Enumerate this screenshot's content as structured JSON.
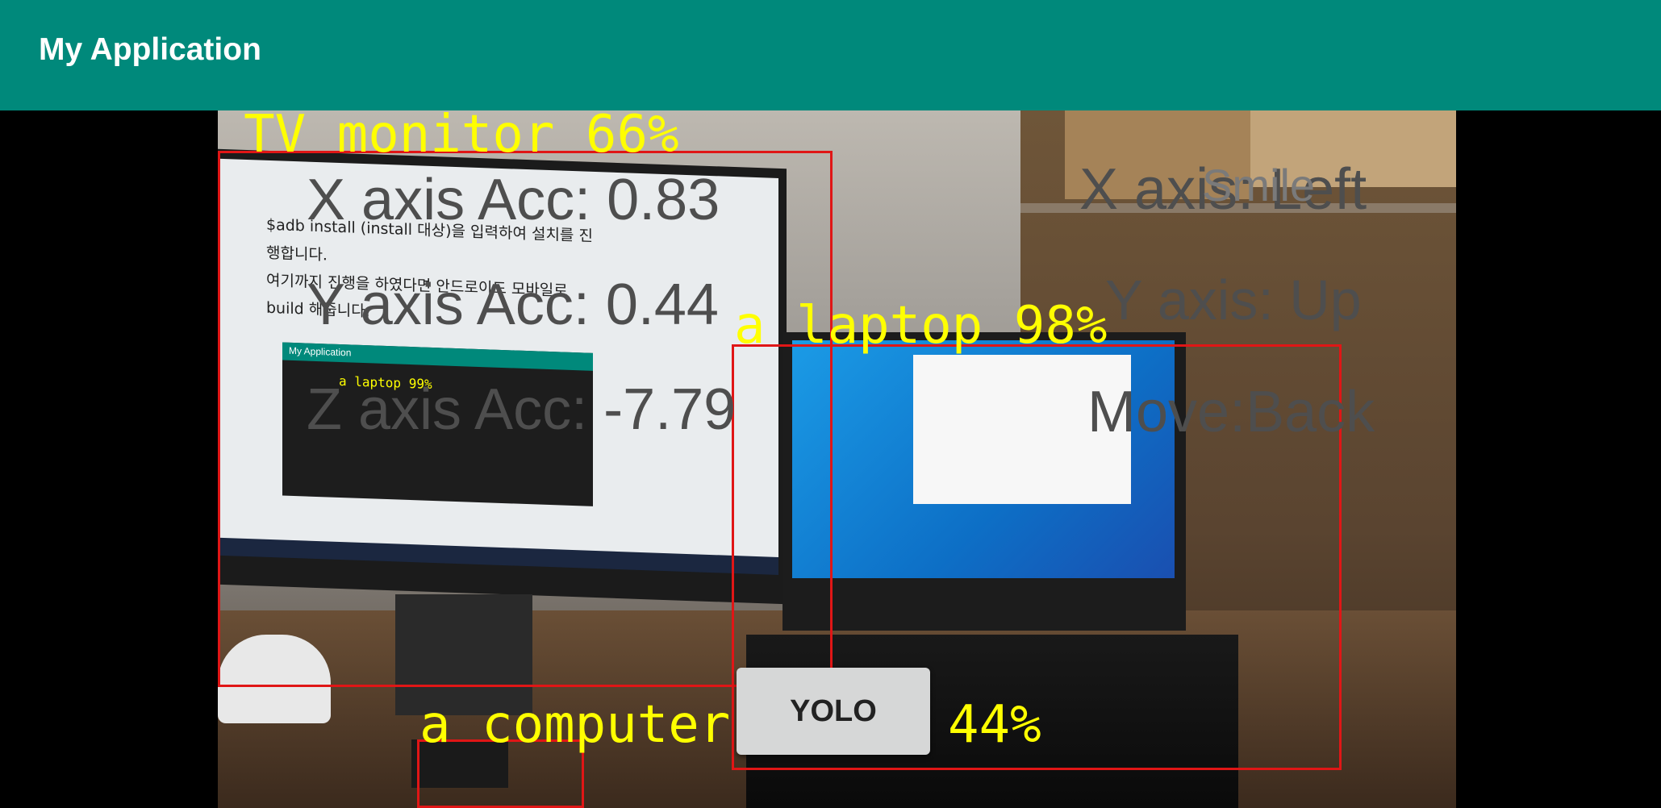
{
  "app": {
    "title": "My Application"
  },
  "detections": [
    {
      "label": "a TV monitor 66%"
    },
    {
      "label": "a laptop 98%"
    },
    {
      "label": "a computer mouse 44%"
    }
  ],
  "sensor": {
    "x_acc": "X axis Acc: 0.83",
    "y_acc": "Y axis Acc: 0.44",
    "z_acc": "Z axis Acc: -7.79",
    "x_dir": "X axis: Left",
    "y_dir": "Y axis: Up",
    "move": "Move:Back",
    "smile": "Smile"
  },
  "screen_text": {
    "line1": "$adb install (install 대상)을 입력하여 설치를 진",
    "line2": "행합니다.",
    "line3": "여기까지 진행을 하였다면 안드로이드 모바일로",
    "line4": "build 해줍니다.",
    "thumb_title": "My Application",
    "thumb_label": "a laptop 99%"
  },
  "button": {
    "label": "YOLO"
  },
  "colors": {
    "appbar": "#00897b",
    "box": "#e01616",
    "label": "#ffff00"
  }
}
